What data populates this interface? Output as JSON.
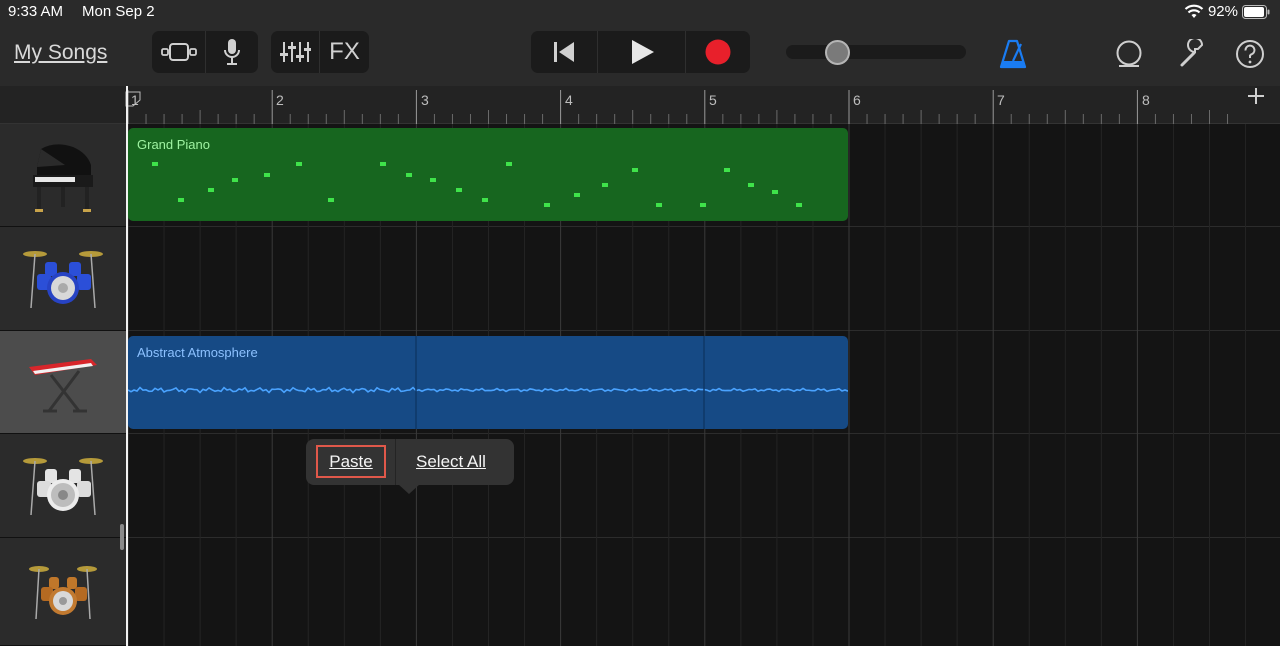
{
  "status_bar": {
    "time": "9:33 AM",
    "date": "Mon Sep 2",
    "battery": "92%"
  },
  "toolbar": {
    "my_songs": "My Songs",
    "fx": "FX",
    "icons": [
      "browser-view-icon",
      "microphone-icon",
      "mixer-icon",
      "rewind-icon",
      "play-icon",
      "record-icon",
      "metronome-icon",
      "loop-icon",
      "settings-wrench-icon",
      "help-icon"
    ],
    "volume_level": 0.25,
    "colors": {
      "record": "#e8202b",
      "metronome": "#1a7cf2"
    }
  },
  "ruler": {
    "bars": [
      "1",
      "2",
      "3",
      "4",
      "5",
      "6",
      "7",
      "8"
    ]
  },
  "tracks": [
    {
      "instrument": "grand-piano",
      "selected": false
    },
    {
      "instrument": "drum-kit-blue",
      "selected": false
    },
    {
      "instrument": "keyboard-synth",
      "selected": true
    },
    {
      "instrument": "drum-kit-white",
      "selected": false
    },
    {
      "instrument": "drum-kit-brown",
      "selected": false
    }
  ],
  "regions": {
    "piano_name": "Grand Piano",
    "atmos_name": "Abstract Atmosphere",
    "colors": {
      "piano": "#17661f",
      "atmosphere": "#164a85"
    }
  },
  "popup": {
    "paste": "Paste",
    "select_all": "Select All"
  }
}
